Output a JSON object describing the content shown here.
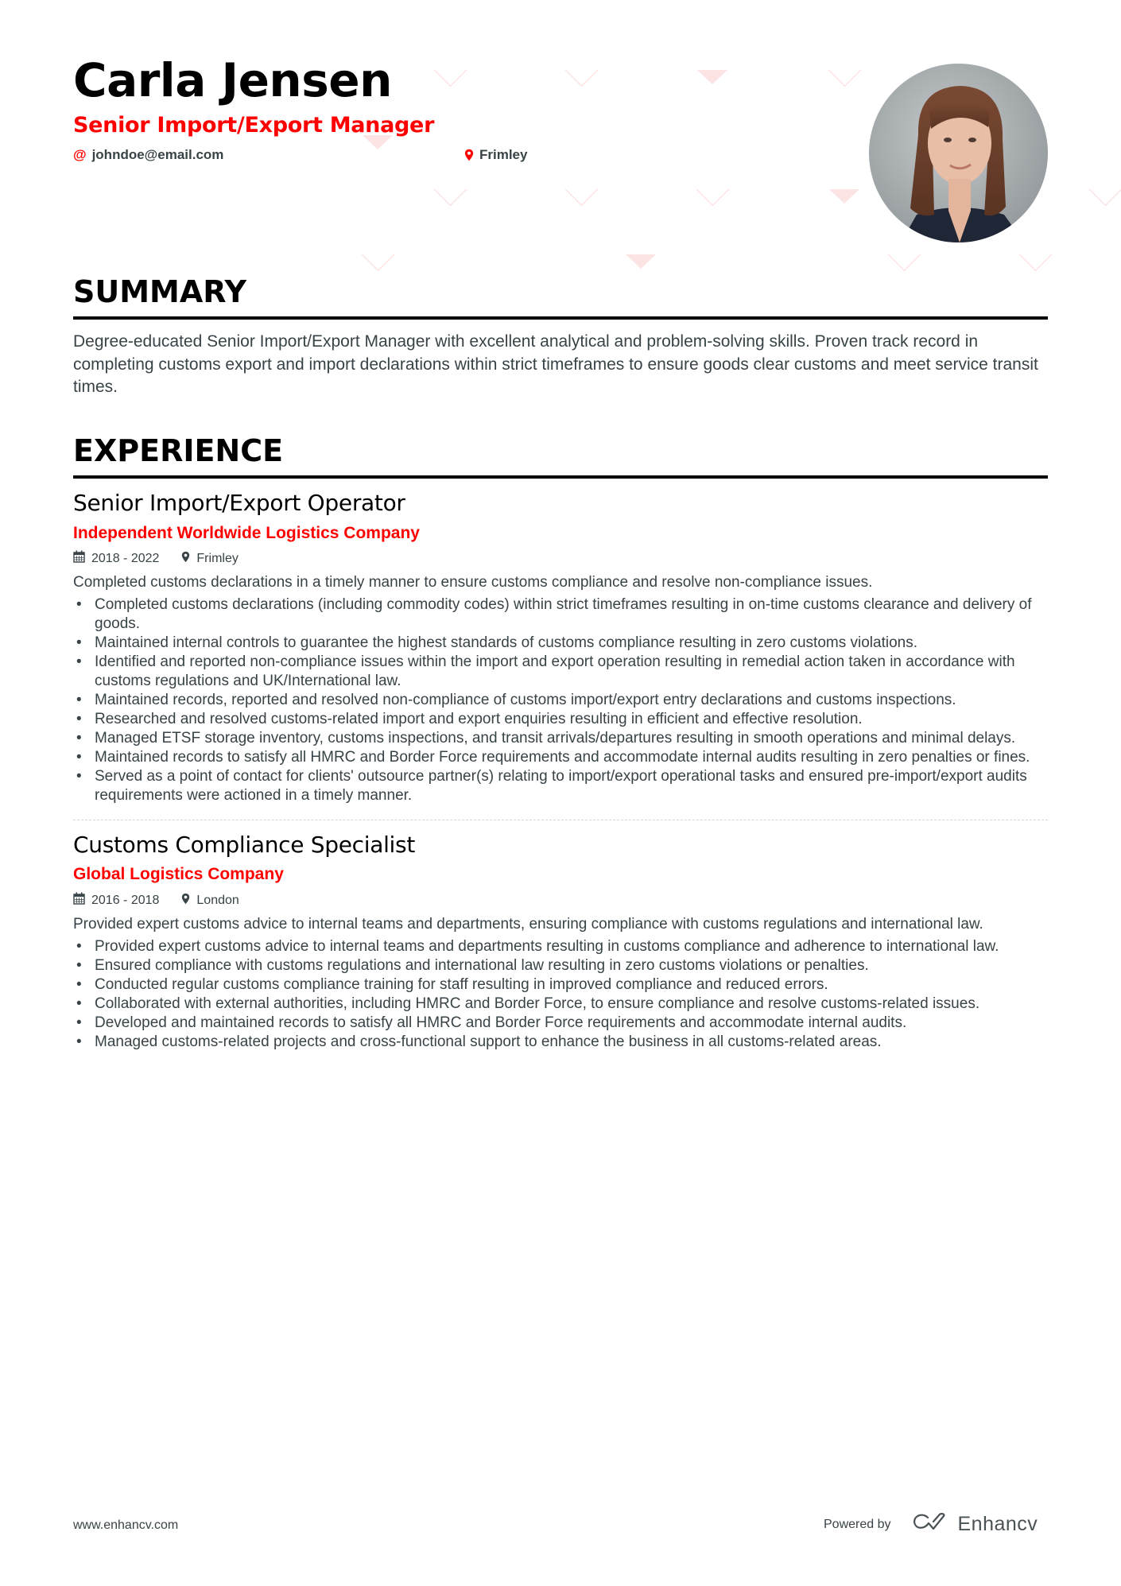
{
  "header": {
    "name": "Carla Jensen",
    "title": "Senior Import/Export Manager",
    "email": "johndoe@email.com",
    "location": "Frimley",
    "email_icon": "at-icon",
    "location_icon": "map-pin-icon",
    "photo_alt": "Profile photo of Carla Jensen"
  },
  "colors": {
    "accent": "#ff0000",
    "text": "#384347",
    "heading": "#000000",
    "pattern": "#fde4e4"
  },
  "summary": {
    "heading": "SUMMARY",
    "text": "Degree-educated Senior Import/Export Manager with excellent analytical and problem-solving skills. Proven track record in completing customs export and import declarations within strict timeframes to ensure goods clear customs and meet service transit times."
  },
  "experience": {
    "heading": "EXPERIENCE",
    "jobs": [
      {
        "title": "Senior Import/Export Operator",
        "company": "Independent Worldwide Logistics Company",
        "dates": "2018 - 2022",
        "location": "Frimley",
        "description": "Completed customs declarations in a timely manner to ensure customs compliance and resolve non-compliance issues.",
        "bullets": [
          "Completed customs declarations (including commodity codes) within strict timeframes resulting in on-time customs clearance and delivery of goods.",
          "Maintained internal controls to guarantee the highest standards of customs compliance resulting in zero customs violations.",
          "Identified and reported non-compliance issues within the import and export operation resulting in remedial action taken in accordance with customs regulations and UK/International law.",
          "Maintained records, reported and resolved non-compliance of customs import/export entry declarations and customs inspections.",
          "Researched and resolved customs-related import and export enquiries resulting in efficient and effective resolution.",
          "Managed ETSF storage inventory, customs inspections, and transit arrivals/departures resulting in smooth operations and minimal delays.",
          "Maintained records to satisfy all HMRC and Border Force requirements and accommodate internal audits resulting in zero penalties or fines.",
          "Served as a point of contact for clients' outsource partner(s) relating to import/export operational tasks and ensured pre-import/export audits requirements were actioned in a timely manner."
        ]
      },
      {
        "title": "Customs Compliance Specialist",
        "company": "Global Logistics Company",
        "dates": "2016 - 2018",
        "location": "London",
        "description": "Provided expert customs advice to internal teams and departments, ensuring compliance with customs regulations and international law.",
        "bullets": [
          "Provided expert customs advice to internal teams and departments resulting in customs compliance and adherence to international law.",
          "Ensured compliance with customs regulations and international law resulting in zero customs violations or penalties.",
          "Conducted regular customs compliance training for staff resulting in improved compliance and reduced errors.",
          "Collaborated with external authorities, including HMRC and Border Force, to ensure compliance and resolve customs-related issues.",
          "Developed and maintained records to satisfy all HMRC and Border Force requirements and accommodate internal audits.",
          "Managed customs-related projects and cross-functional support to enhance the business in all customs-related areas."
        ]
      }
    ]
  },
  "footer": {
    "website": "www.enhancv.com",
    "powered_by": "Powered by",
    "brand": "Enhancv"
  }
}
